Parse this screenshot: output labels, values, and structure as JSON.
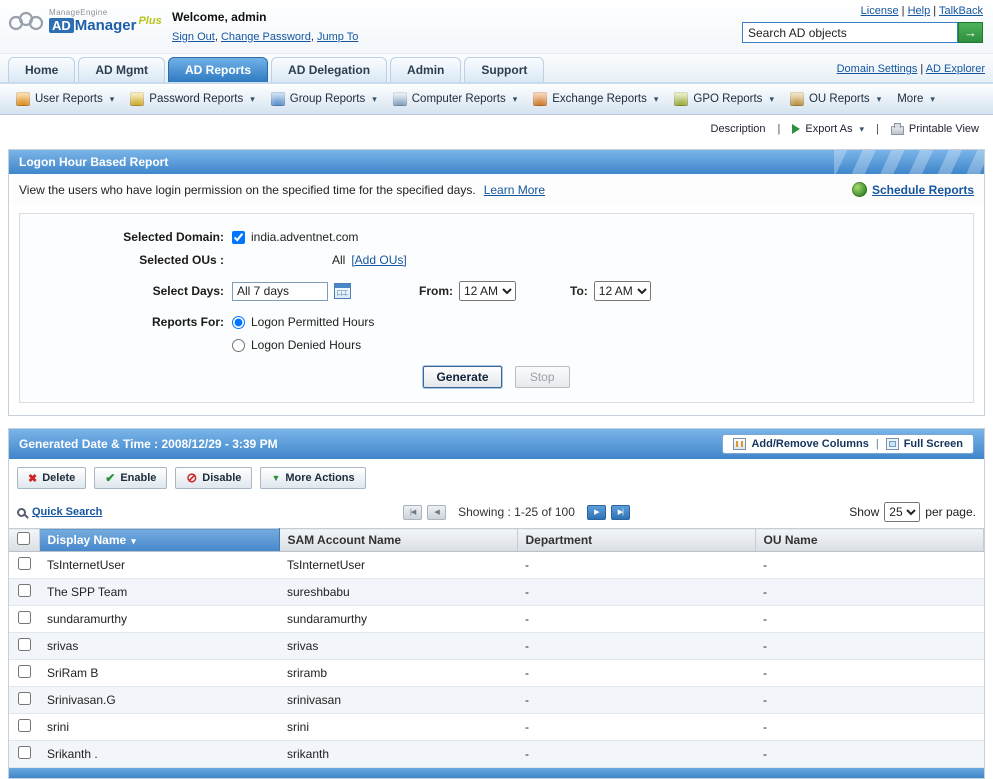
{
  "header": {
    "brand_top": "ManageEngine",
    "brand_ad": "AD",
    "brand_manager": "Manager",
    "brand_plus": "Plus",
    "welcome_label": "Welcome,",
    "username": "admin",
    "session_links": [
      "Sign Out",
      "Change Password",
      "Jump To"
    ],
    "session_separator": ", ",
    "top_links": [
      "License",
      "Help",
      "TalkBack"
    ],
    "top_separator": " | ",
    "search_value": "Search AD objects"
  },
  "nav": {
    "tabs": [
      {
        "label": "Home",
        "active": false
      },
      {
        "label": "AD Mgmt",
        "active": false
      },
      {
        "label": "AD Reports",
        "active": true
      },
      {
        "label": "AD Delegation",
        "active": false
      },
      {
        "label": "Admin",
        "active": false
      },
      {
        "label": "Support",
        "active": false
      }
    ],
    "right_links": [
      "Domain Settings",
      "AD Explorer"
    ],
    "right_separator": " | "
  },
  "reports_menu": [
    {
      "label": "User Reports",
      "icon": "user-reports-icon"
    },
    {
      "label": "Password Reports",
      "icon": "password-reports-icon"
    },
    {
      "label": "Group Reports",
      "icon": "group-reports-icon"
    },
    {
      "label": "Computer Reports",
      "icon": "computer-reports-icon"
    },
    {
      "label": "Exchange Reports",
      "icon": "exchange-reports-icon"
    },
    {
      "label": "GPO Reports",
      "icon": "gpo-reports-icon"
    },
    {
      "label": "OU Reports",
      "icon": "ou-reports-icon"
    },
    {
      "label": "More",
      "icon": null
    }
  ],
  "toolbar": {
    "description_label": "Description",
    "export_label": "Export As",
    "printable_label": "Printable View",
    "separator": "|"
  },
  "report_panel": {
    "title": "Logon Hour Based Report",
    "description": "View the users who have login permission on the specified time for the specified days.",
    "learn_more_label": "Learn More",
    "schedule_reports_label": "Schedule Reports",
    "form": {
      "selected_domain_label": "Selected Domain:",
      "domain": "india.adventnet.com",
      "selected_ous_label": "Selected OUs :",
      "selected_ous_value": "All",
      "add_ous_label": "[Add OUs]",
      "select_days_label": "Select Days:",
      "select_days_value": "All 7 days",
      "from_label": "From:",
      "from_value": "12 AM",
      "to_label": "To:",
      "to_value": "12 AM",
      "reports_for_label": "Reports For:",
      "option_permitted": "Logon Permitted Hours",
      "option_denied": "Logon Denied Hours",
      "generate_label": "Generate",
      "stop_label": "Stop"
    }
  },
  "results_panel": {
    "title": "Generated Date & Time : 2008/12/29 - 3:39 PM",
    "add_remove_columns_label": "Add/Remove Columns",
    "full_screen_label": "Full Screen",
    "header_separator": "|",
    "action_buttons": [
      {
        "label": "Delete",
        "icon": "delete-icon"
      },
      {
        "label": "Enable",
        "icon": "enable-icon"
      },
      {
        "label": "Disable",
        "icon": "disable-icon"
      },
      {
        "label": "More Actions",
        "icon": "more-actions-icon"
      }
    ],
    "quick_search_label": "Quick Search",
    "pagination": {
      "showing_text": "Showing : 1-25 of 100"
    },
    "show_label": "Show",
    "page_size": "25",
    "per_page_label": "per page.",
    "table": {
      "columns": [
        "Display Name",
        "SAM Account Name",
        "Department",
        "OU Name"
      ],
      "rows": [
        [
          "TsInternetUser",
          "TsInternetUser",
          "-",
          "-"
        ],
        [
          "The SPP Team",
          "sureshbabu",
          "-",
          "-"
        ],
        [
          "sundaramurthy",
          "sundaramurthy",
          "-",
          "-"
        ],
        [
          "srivas",
          "srivas",
          "-",
          "-"
        ],
        [
          "SriRam B",
          "sriramb",
          "-",
          "-"
        ],
        [
          "Srinivasan.G",
          "srinivasan",
          "-",
          "-"
        ],
        [
          "srini",
          "srini",
          "-",
          "-"
        ],
        [
          "Srikanth .",
          "srikanth",
          "-",
          "-"
        ]
      ]
    }
  },
  "colors": {
    "panel_header_blue": "#4a8fd0",
    "link_blue": "#15569e",
    "search_button_green": "#2e8f3e",
    "table_header_blue": "#4688cc"
  }
}
